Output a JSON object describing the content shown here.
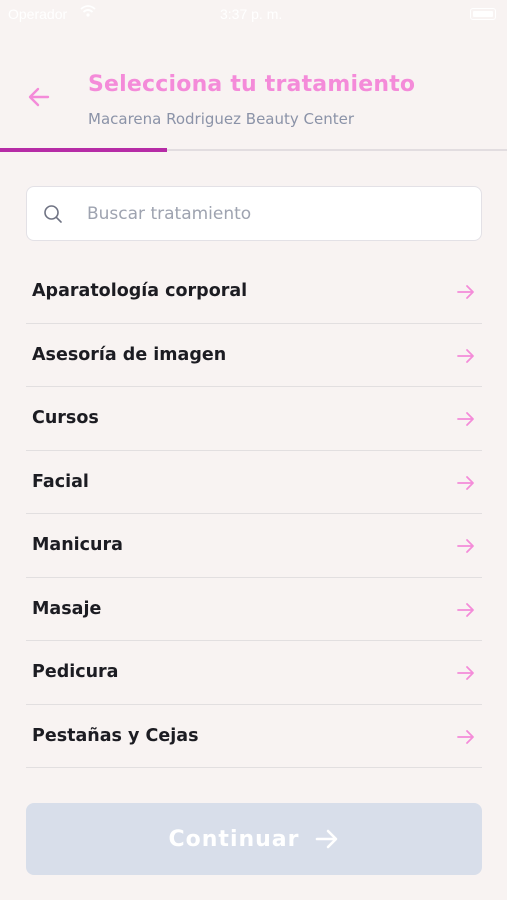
{
  "status_bar": {
    "carrier": "Operador",
    "time": "3:37 p. m."
  },
  "header": {
    "title": "Selecciona tu tratamiento",
    "subtitle": "Macarena Rodriguez Beauty Center",
    "back_icon": "arrow-left-icon"
  },
  "progress": {
    "value": 0.33
  },
  "search": {
    "placeholder": "Buscar tratamiento",
    "value": "",
    "icon": "search-icon"
  },
  "categories": [
    {
      "label": "Aparatología corporal"
    },
    {
      "label": "Asesoría de imagen"
    },
    {
      "label": "Cursos"
    },
    {
      "label": "Facial"
    },
    {
      "label": "Manicura"
    },
    {
      "label": "Masaje"
    },
    {
      "label": "Pedicura"
    },
    {
      "label": "Pestañas y Cejas"
    }
  ],
  "continue_button": {
    "label": "Continuar",
    "icon": "arrow-right-icon",
    "state": "disabled"
  },
  "colors": {
    "accent": "#f48bd9",
    "progress": "#b62ba6",
    "button_disabled": "#d8deea",
    "background": "#f8f3f2"
  }
}
